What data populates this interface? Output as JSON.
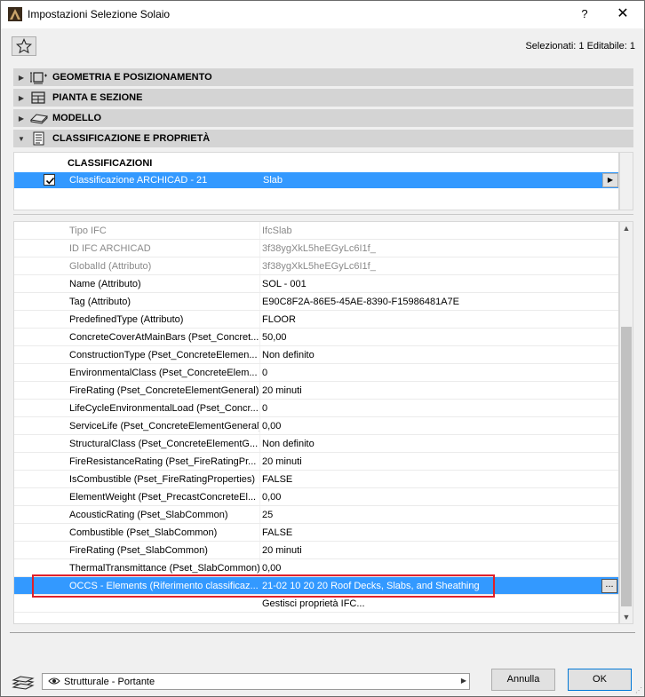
{
  "window": {
    "title": "Impostazioni Selezione Solaio",
    "help": "?",
    "close": "✕"
  },
  "header": {
    "selection_info": "Selezionati: 1 Editabile: 1"
  },
  "sections": [
    {
      "label": "GEOMETRIA E POSIZIONAMENTO",
      "expanded": false
    },
    {
      "label": "PIANTA E SEZIONE",
      "expanded": false
    },
    {
      "label": "MODELLO",
      "expanded": false
    },
    {
      "label": "CLASSIFICAZIONE E PROPRIETÀ",
      "expanded": true
    }
  ],
  "classifications": {
    "heading": "CLASSIFICAZIONI",
    "row": {
      "system": "Classificazione ARCHICAD - 21",
      "value": "Slab",
      "checked": true
    }
  },
  "properties": [
    {
      "name": "Tipo IFC",
      "value": "IfcSlab",
      "dim": true
    },
    {
      "name": "ID IFC ARCHICAD",
      "value": "3f38ygXkL5heEGyLc6I1f_",
      "dim": true
    },
    {
      "name": "GlobalId (Attributo)",
      "value": "3f38ygXkL5heEGyLc6I1f_",
      "dim": true
    },
    {
      "name": "Name (Attributo)",
      "value": "SOL - 001"
    },
    {
      "name": "Tag (Attributo)",
      "value": "E90C8F2A-86E5-45AE-8390-F15986481A7E"
    },
    {
      "name": "PredefinedType (Attributo)",
      "value": "FLOOR"
    },
    {
      "name": "ConcreteCoverAtMainBars (Pset_ConcreteElementGeneral)",
      "value": "50,00"
    },
    {
      "name": "ConstructionType (Pset_ConcreteElementGeneral)",
      "value": "Non definito"
    },
    {
      "name": "EnvironmentalClass (Pset_ConcreteElementGeneral)",
      "value": "0"
    },
    {
      "name": "FireRating (Pset_ConcreteElementGeneral)",
      "value": "20 minuti"
    },
    {
      "name": "LifeCycleEnvironmentalLoad (Pset_ConcreteElementGeneral)",
      "value": "0"
    },
    {
      "name": "ServiceLife (Pset_ConcreteElementGeneral)",
      "value": "0,00"
    },
    {
      "name": "StructuralClass (Pset_ConcreteElementGeneral)",
      "value": "Non definito"
    },
    {
      "name": "FireResistanceRating (Pset_FireRatingProperties)",
      "value": "20 minuti"
    },
    {
      "name": "IsCombustible (Pset_FireRatingProperties)",
      "value": "FALSE"
    },
    {
      "name": "ElementWeight (Pset_PrecastConcreteElementGeneral)",
      "value": "0,00"
    },
    {
      "name": "AcousticRating (Pset_SlabCommon)",
      "value": "25"
    },
    {
      "name": "Combustible (Pset_SlabCommon)",
      "value": "FALSE"
    },
    {
      "name": "FireRating (Pset_SlabCommon)",
      "value": "20 minuti"
    },
    {
      "name": "ThermalTransmittance (Pset_SlabCommon)",
      "value": "0,00"
    },
    {
      "name": "OCCS - Elements (Riferimento classificazione)",
      "value": "21-02 10 20 20 Roof Decks, Slabs, and Sheathing",
      "selected": true,
      "button": "..."
    },
    {
      "name": "",
      "value": "Gestisci proprietà IFC..."
    }
  ],
  "property_names_display": [
    "Tipo IFC",
    "ID IFC ARCHICAD",
    "GlobalId (Attributo)",
    "Name (Attributo)",
    "Tag (Attributo)",
    "PredefinedType (Attributo)",
    "ConcreteCoverAtMainBars (Pset_Concret...",
    "ConstructionType (Pset_ConcreteElemen...",
    "EnvironmentalClass (Pset_ConcreteElem...",
    "FireRating (Pset_ConcreteElementGeneral)",
    "LifeCycleEnvironmentalLoad (Pset_Concr...",
    "ServiceLife (Pset_ConcreteElementGeneral)",
    "StructuralClass (Pset_ConcreteElementG...",
    "FireResistanceRating (Pset_FireRatingPr...",
    "IsCombustible (Pset_FireRatingProperties)",
    "ElementWeight (Pset_PrecastConcreteEl...",
    "AcousticRating (Pset_SlabCommon)",
    "Combustible (Pset_SlabCommon)",
    "FireRating (Pset_SlabCommon)",
    "ThermalTransmittance (Pset_SlabCommon)",
    "OCCS - Elements (Riferimento classificaz...",
    ""
  ],
  "footer": {
    "layer": "Strutturale - Portante",
    "cancel_label": "Annulla",
    "ok_label": "OK"
  },
  "colors": {
    "selection": "#3399ff",
    "highlight_box": "#e0202a",
    "section_bg": "#d4d4d4"
  }
}
